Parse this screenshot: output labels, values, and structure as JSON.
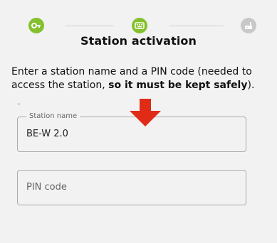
{
  "stepper": {
    "steps": [
      {
        "icon": "key-icon",
        "state": "done",
        "color": "#85c02d"
      },
      {
        "icon": "keyboard-icon",
        "state": "current",
        "color": "#85c02d"
      },
      {
        "icon": "router-icon",
        "state": "pending",
        "color": "#c8c8c8"
      }
    ]
  },
  "page": {
    "title": "Station activation",
    "description_plain": "Enter a station name and a PIN code (needed to access the station, ",
    "description_emphasis": "so it must be kept safely",
    "description_end": ").",
    "dot_mark": "."
  },
  "form": {
    "station_name": {
      "label": "Station name",
      "value": "BE-W 2.0"
    },
    "pin_code": {
      "placeholder": "PIN code",
      "value": ""
    }
  },
  "annotation": {
    "arrow_color": "#e02b17",
    "arrow_icon": "arrow-down-icon"
  }
}
